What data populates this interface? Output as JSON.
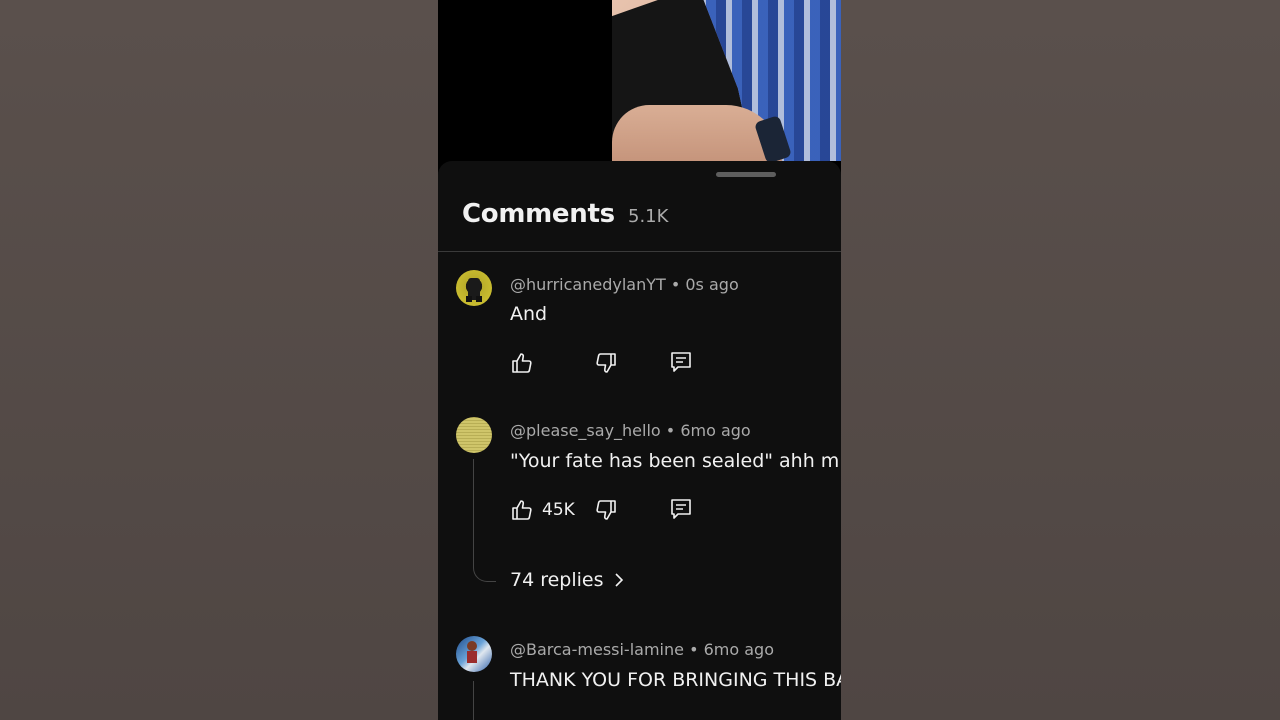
{
  "comments_panel": {
    "title": "Comments",
    "count": "5.1K"
  },
  "comments": [
    {
      "handle": "@hurricanedylanYT",
      "time": "0s ago",
      "text": "And",
      "likes": ""
    },
    {
      "handle": "@please_say_hello",
      "time": "6mo ago",
      "text": "\"Your fate has been sealed\" ahh m",
      "likes": "45K",
      "replies": "74 replies"
    },
    {
      "handle": "@Barca-messi-lamine",
      "time": "6mo ago",
      "text": "THANK YOU FOR BRINGING THIS BA"
    }
  ],
  "colors": {
    "page_bg": "#544b48",
    "sheet_bg": "#0f0f0f",
    "text_primary": "#f1f1f1",
    "text_secondary": "#aaaaaa"
  },
  "icons": [
    "like-icon",
    "dislike-icon",
    "reply-icon",
    "chevron-right-icon"
  ]
}
